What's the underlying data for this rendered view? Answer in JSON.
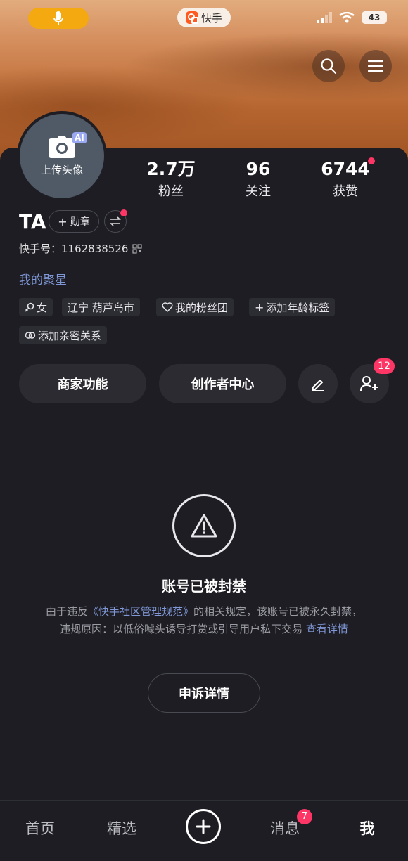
{
  "status_bar": {
    "app_name": "快手",
    "battery": "43"
  },
  "profile": {
    "avatar_label": "上传头像",
    "ai_badge": "AI",
    "username": "TA",
    "medal_label": "勋章",
    "kuaishou_id": "快手号：1162838526",
    "featured_link": "我的聚星"
  },
  "stats": [
    {
      "value": "2.7万",
      "label": "粉丝"
    },
    {
      "value": "96",
      "label": "关注"
    },
    {
      "value": "6744",
      "label": "获赞"
    }
  ],
  "tags": {
    "gender": "女",
    "location": "辽宁 葫芦岛市",
    "fan_group": "我的粉丝团",
    "add_age": "添加年龄标签",
    "add_relation": "添加亲密关系"
  },
  "actions": {
    "merchant": "商家功能",
    "creator": "创作者中心",
    "friend_badge": "12"
  },
  "ban": {
    "title": "账号已被封禁",
    "desc_prefix": "由于违反",
    "desc_link": "《快手社区管理规范》",
    "desc_body": "的相关规定，该账号已被永久封禁，违规原因：以低俗噱头诱导打赏或引导用户私下交易",
    "details_link": "查看详情",
    "appeal_button": "申诉详情"
  },
  "tabbar": {
    "home": "首页",
    "featured": "精选",
    "messages": "消息",
    "messages_badge": "7",
    "me": "我"
  },
  "colors": {
    "accent_red": "#fe3666",
    "link_blue": "#7f97d6",
    "background": "#1d1d23"
  }
}
